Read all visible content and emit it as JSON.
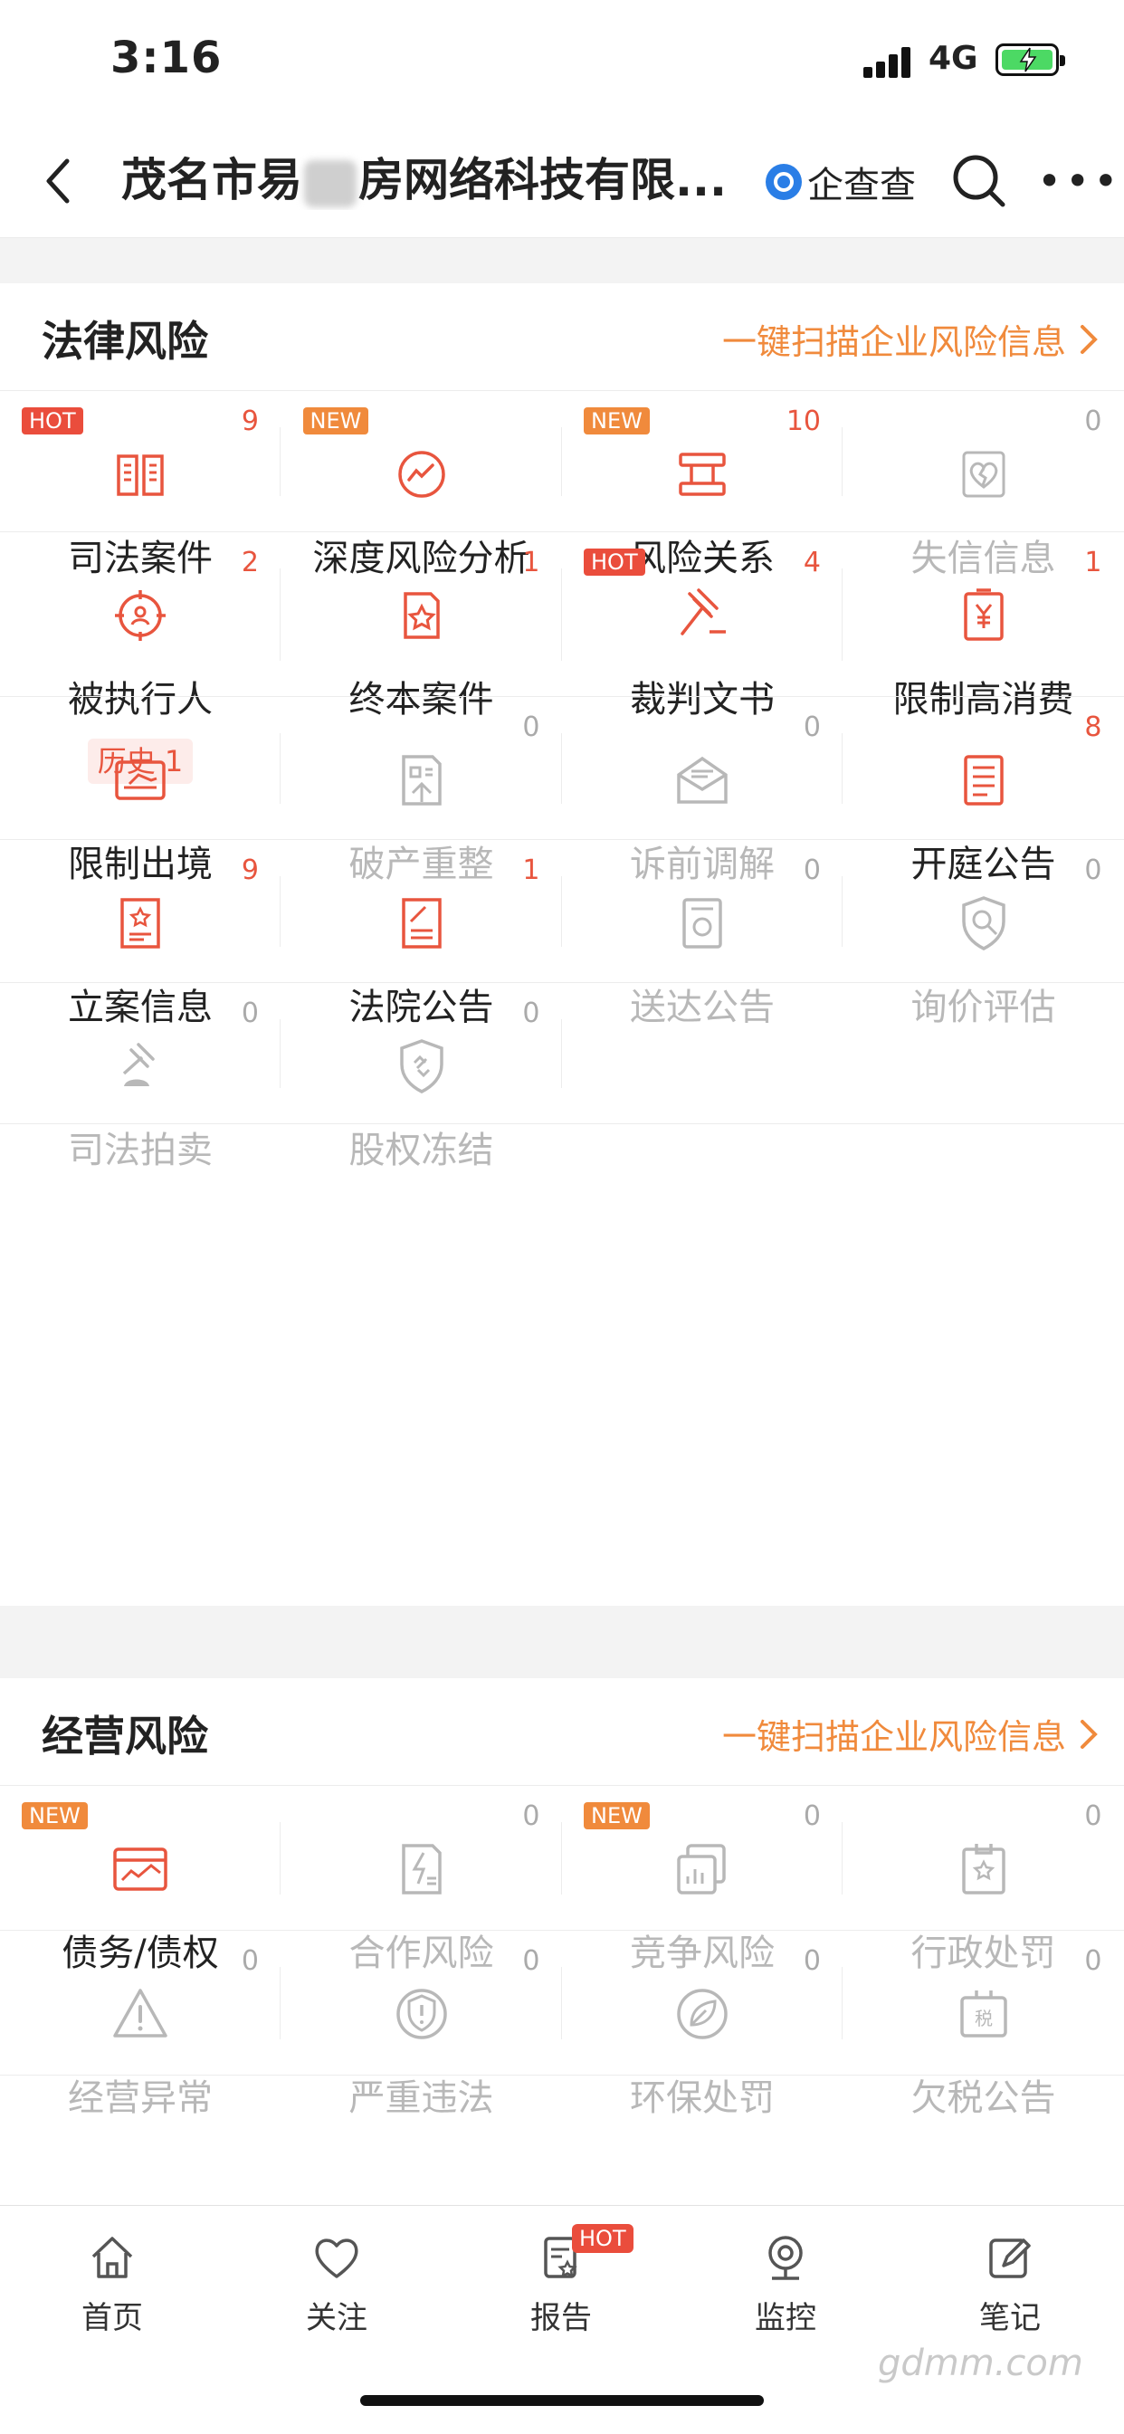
{
  "status_bar": {
    "time": "3:16",
    "network": "4G"
  },
  "nav": {
    "title_prefix": "茂名市易",
    "title_suffix": "房网络科技有限...",
    "brand": "企查查"
  },
  "legal": {
    "title": "法律风险",
    "scan_link": "一键扫描企业风险信息",
    "items": [
      {
        "label": "司法案件",
        "count": "9",
        "badge": "HOT"
      },
      {
        "label": "深度风险分析",
        "count": "",
        "badge": "NEW"
      },
      {
        "label": "风险关系",
        "count": "10",
        "badge": "NEW"
      },
      {
        "label": "失信信息",
        "count": "0",
        "badge": ""
      },
      {
        "label": "被执行人",
        "count": "2",
        "badge": "",
        "history": "历史 1"
      },
      {
        "label": "终本案件",
        "count": "1",
        "badge": ""
      },
      {
        "label": "裁判文书",
        "count": "4",
        "badge": "HOT"
      },
      {
        "label": "限制高消费",
        "count": "1",
        "badge": ""
      },
      {
        "label": "限制出境",
        "count": "",
        "badge": ""
      },
      {
        "label": "破产重整",
        "count": "0",
        "badge": ""
      },
      {
        "label": "诉前调解",
        "count": "0",
        "badge": ""
      },
      {
        "label": "开庭公告",
        "count": "8",
        "badge": ""
      },
      {
        "label": "立案信息",
        "count": "9",
        "badge": ""
      },
      {
        "label": "法院公告",
        "count": "1",
        "badge": ""
      },
      {
        "label": "送达公告",
        "count": "0",
        "badge": ""
      },
      {
        "label": "询价评估",
        "count": "0",
        "badge": ""
      },
      {
        "label": "司法拍卖",
        "count": "0",
        "badge": ""
      },
      {
        "label": "股权冻结",
        "count": "0",
        "badge": ""
      }
    ]
  },
  "business": {
    "title": "经营风险",
    "scan_link": "一键扫描企业风险信息",
    "items": [
      {
        "label": "债务/债权",
        "count": "",
        "badge": "NEW"
      },
      {
        "label": "合作风险",
        "count": "0",
        "badge": ""
      },
      {
        "label": "竞争风险",
        "count": "0",
        "badge": "NEW"
      },
      {
        "label": "行政处罚",
        "count": "0",
        "badge": ""
      },
      {
        "label": "经营异常",
        "count": "0",
        "badge": ""
      },
      {
        "label": "严重违法",
        "count": "0",
        "badge": ""
      },
      {
        "label": "环保处罚",
        "count": "0",
        "badge": ""
      },
      {
        "label": "欠税公告",
        "count": "0",
        "badge": ""
      }
    ]
  },
  "icons": [
    "book-icon",
    "chart-circle-icon",
    "relation-icon",
    "broken-heart-icon",
    "target-person-icon",
    "star-doc-icon",
    "gavel-icon",
    "yen-doc-icon",
    "plane-icon",
    "doc-arrow-icon",
    "envelope-icon",
    "list-doc-icon",
    "star-file-icon",
    "doc-pen-icon",
    "medal-doc-icon",
    "shield-search-icon",
    "auction-icon",
    "shield-link-icon",
    "card-chart-icon",
    "doc-bolt-icon",
    "stack-chart-icon",
    "badge-star-icon",
    "warning-icon",
    "shield-alert-icon",
    "leaf-icon",
    "tax-icon"
  ],
  "tabs": [
    {
      "label": "首页"
    },
    {
      "label": "关注"
    },
    {
      "label": "报告",
      "badge": "HOT"
    },
    {
      "label": "监控"
    },
    {
      "label": "笔记"
    }
  ],
  "watermark": "gdmm.com",
  "colors": {
    "accent": "#e8553e",
    "orange": "#f08a3c",
    "muted": "#b8b8b8"
  }
}
